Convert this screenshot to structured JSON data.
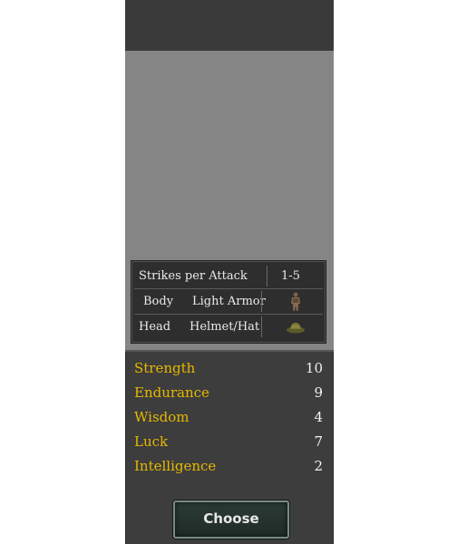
{
  "info_table": {
    "strikes": {
      "label": "Strikes per Attack",
      "value": "1-5"
    },
    "body": {
      "label": "Body",
      "value": "Light Armor",
      "icon": "light-armor-icon"
    },
    "head": {
      "label": "Head",
      "value": "Helmet/Hat",
      "icon": "helmet-icon"
    }
  },
  "stats": [
    {
      "name": "Strength",
      "value": "10"
    },
    {
      "name": "Endurance",
      "value": "9"
    },
    {
      "name": "Wisdom",
      "value": "4"
    },
    {
      "name": "Luck",
      "value": "7"
    },
    {
      "name": "Intelligence",
      "value": "2"
    }
  ],
  "choose_button": {
    "label": "Choose"
  },
  "colors": {
    "stat_name": "#e6b800",
    "panel_bg": "#3d3d3d",
    "preview_bg": "#858585"
  }
}
